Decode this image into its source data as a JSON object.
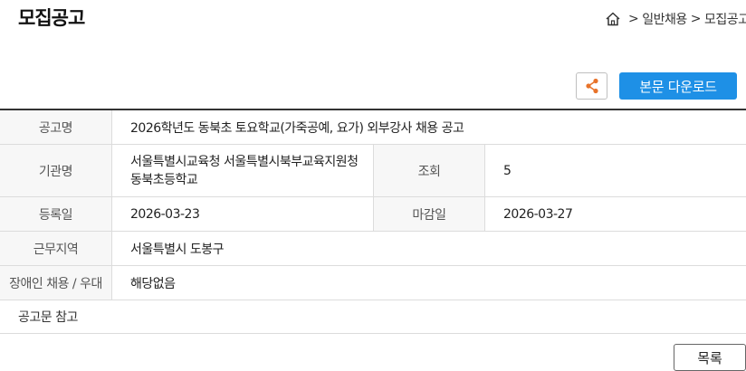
{
  "page": {
    "title": "모집공고"
  },
  "breadcrumb": {
    "items": [
      "일반채용",
      "모집공고"
    ],
    "separator": ">"
  },
  "actions": {
    "share_icon": "share-icon",
    "download_label": "본문 다운로드",
    "list_label": "목록"
  },
  "colors": {
    "accent": "#1e90e6",
    "share_icon": "#e8732a"
  },
  "table": {
    "title": {
      "label": "공고명",
      "value": "2026학년도 동북초 토요학교(가죽공예, 요가) 외부강사 채용 공고"
    },
    "agency": {
      "label": "기관명",
      "value": "서울특별시교육청 서울특별시북부교육지원청 동북초등학교"
    },
    "views": {
      "label": "조회",
      "value": "5"
    },
    "registered": {
      "label": "등록일",
      "value": "2026-03-23"
    },
    "deadline": {
      "label": "마감일",
      "value": "2026-03-27"
    },
    "location": {
      "label": "근무지역",
      "value": "서울특별시 도봉구"
    },
    "disability": {
      "label": "장애인 채용 / 우대",
      "value": "해당없음"
    }
  },
  "notice": "공고문 참고"
}
